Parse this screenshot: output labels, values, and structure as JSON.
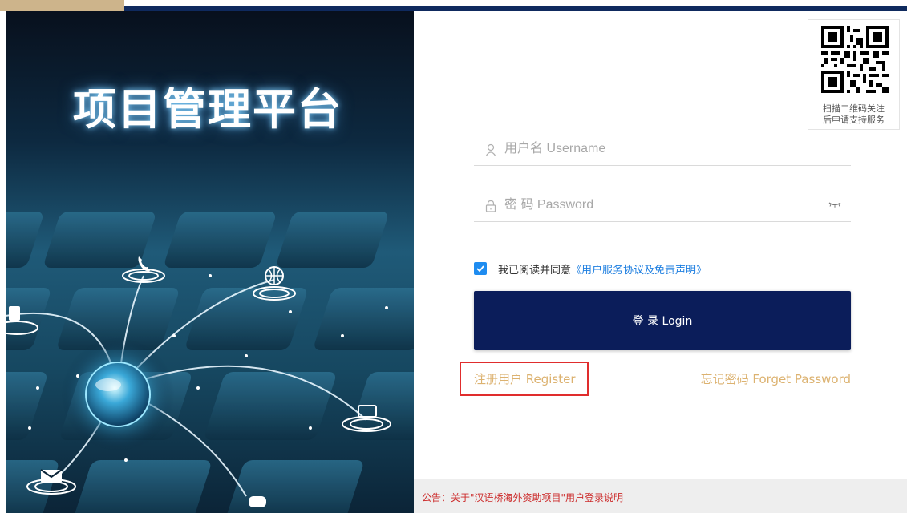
{
  "hero": {
    "title": "项目管理平台"
  },
  "qr": {
    "caption_line1": "扫描二维码关注",
    "caption_line2": "后申请支持服务"
  },
  "login_form": {
    "username_placeholder": "用户名 Username",
    "password_placeholder": "密 码 Password",
    "agree_text": "我已阅读并同意",
    "agreement_link": "《用户服务协议及免责声明》",
    "agree_checked": true,
    "login_button": "登 录 Login",
    "register_link": "注册用户 Register",
    "forgot_link": "忘记密码 Forget Password"
  },
  "notice": {
    "text": "公告：关于\"汉语桥海外资助项目\"用户登录说明"
  },
  "colors": {
    "top_bar": "#0f2a5e",
    "top_accent": "#cdb48b",
    "login_button_bg": "#0b1d5a",
    "link_gold": "#dcb270",
    "link_blue": "#1f7fe0",
    "checkbox_blue": "#1e8cf0",
    "notice_red": "#cc2a2a",
    "highlight_red": "#e02d2d"
  },
  "icons": {
    "username": "user-icon",
    "password": "lock-icon",
    "toggle_password": "eye-closed-icon",
    "checkbox": "check-icon",
    "qr": "qr-code-icon"
  }
}
